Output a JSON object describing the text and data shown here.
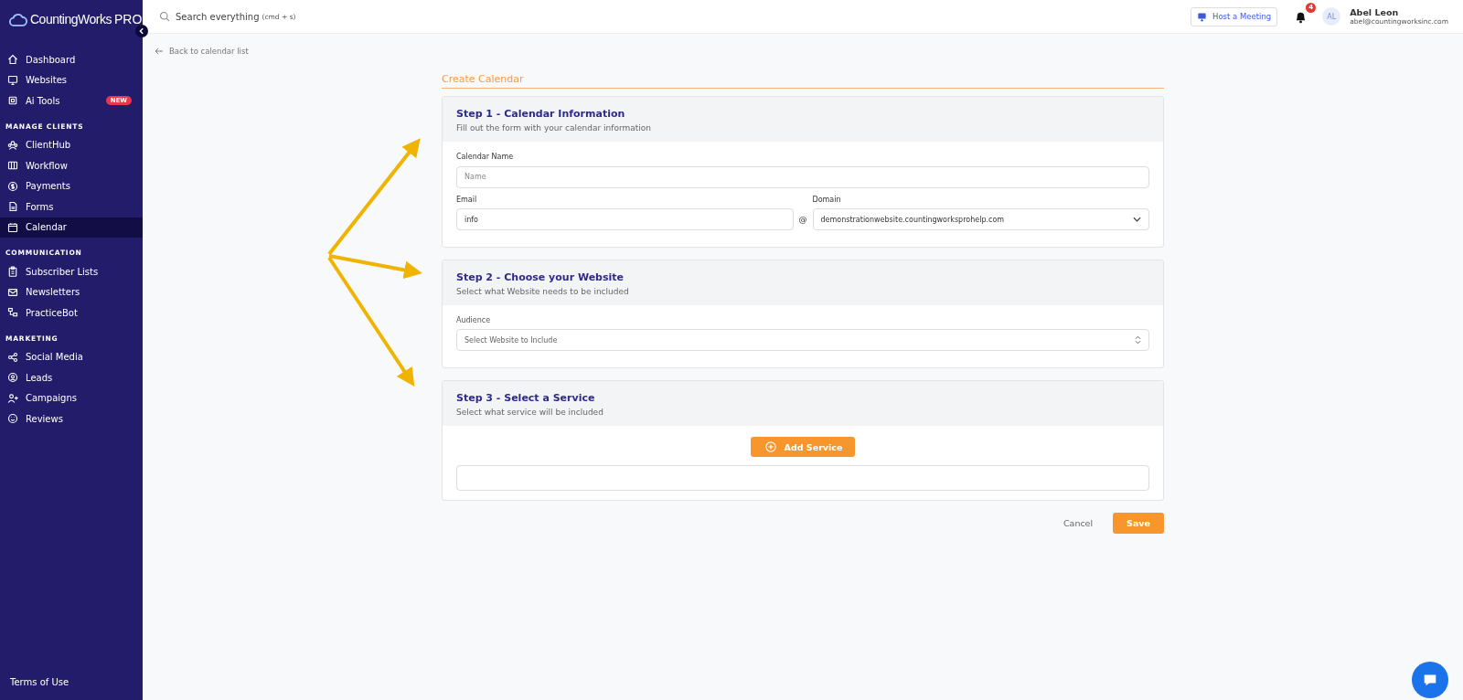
{
  "sidebar": {
    "brand": "CountingWorks",
    "brand_suffix": "PRO",
    "sections": [
      {
        "items": [
          {
            "label": "Dashboard",
            "selected": false
          },
          {
            "label": "Websites",
            "selected": false
          },
          {
            "label": "Ai Tools",
            "selected": false,
            "badge": "NEW"
          }
        ]
      },
      {
        "heading": "MANAGE CLIENTS",
        "items": [
          {
            "label": "ClientHub",
            "selected": false
          },
          {
            "label": "Workflow",
            "selected": false
          },
          {
            "label": "Payments",
            "selected": false
          },
          {
            "label": "Forms",
            "selected": false
          },
          {
            "label": "Calendar",
            "selected": true
          }
        ]
      },
      {
        "heading": "COMMUNICATION",
        "items": [
          {
            "label": "Subscriber Lists",
            "selected": false
          },
          {
            "label": "Newsletters",
            "selected": false
          },
          {
            "label": "PracticeBot",
            "selected": false
          }
        ]
      },
      {
        "heading": "MARKETING",
        "items": [
          {
            "label": "Social Media",
            "selected": false
          },
          {
            "label": "Leads",
            "selected": false
          },
          {
            "label": "Campaigns",
            "selected": false
          },
          {
            "label": "Reviews",
            "selected": false
          }
        ]
      }
    ],
    "footer_link": "Terms of Use"
  },
  "topbar": {
    "search_placeholder": "Search everything",
    "search_hint": "(cmd + s)",
    "host_button": "Host a Meeting",
    "notification_count": "4",
    "user": {
      "initials": "AL",
      "name": "Abel Leon",
      "email": "abel@countingworksinc.com"
    }
  },
  "back_link": "Back to calendar list",
  "page_title": "Create Calendar",
  "step1": {
    "title": "Step 1 - Calendar Information",
    "subtitle": "Fill out the form with your calendar information",
    "name_label": "Calendar Name",
    "name_placeholder": "Name",
    "email_label": "Email",
    "email_value": "info",
    "at_sign": "@",
    "domain_label": "Domain",
    "domain_value": "demonstrationwebsite.countingworksprohelp.com"
  },
  "step2": {
    "title": "Step 2 - Choose your Website",
    "subtitle": "Select what Website needs to be included",
    "audience_label": "Audience",
    "audience_placeholder": "Select Website to Include"
  },
  "step3": {
    "title": "Step 3 - Select a Service",
    "subtitle": "Select what service will be included",
    "add_button": "Add Service"
  },
  "actions": {
    "cancel": "Cancel",
    "save": "Save"
  }
}
